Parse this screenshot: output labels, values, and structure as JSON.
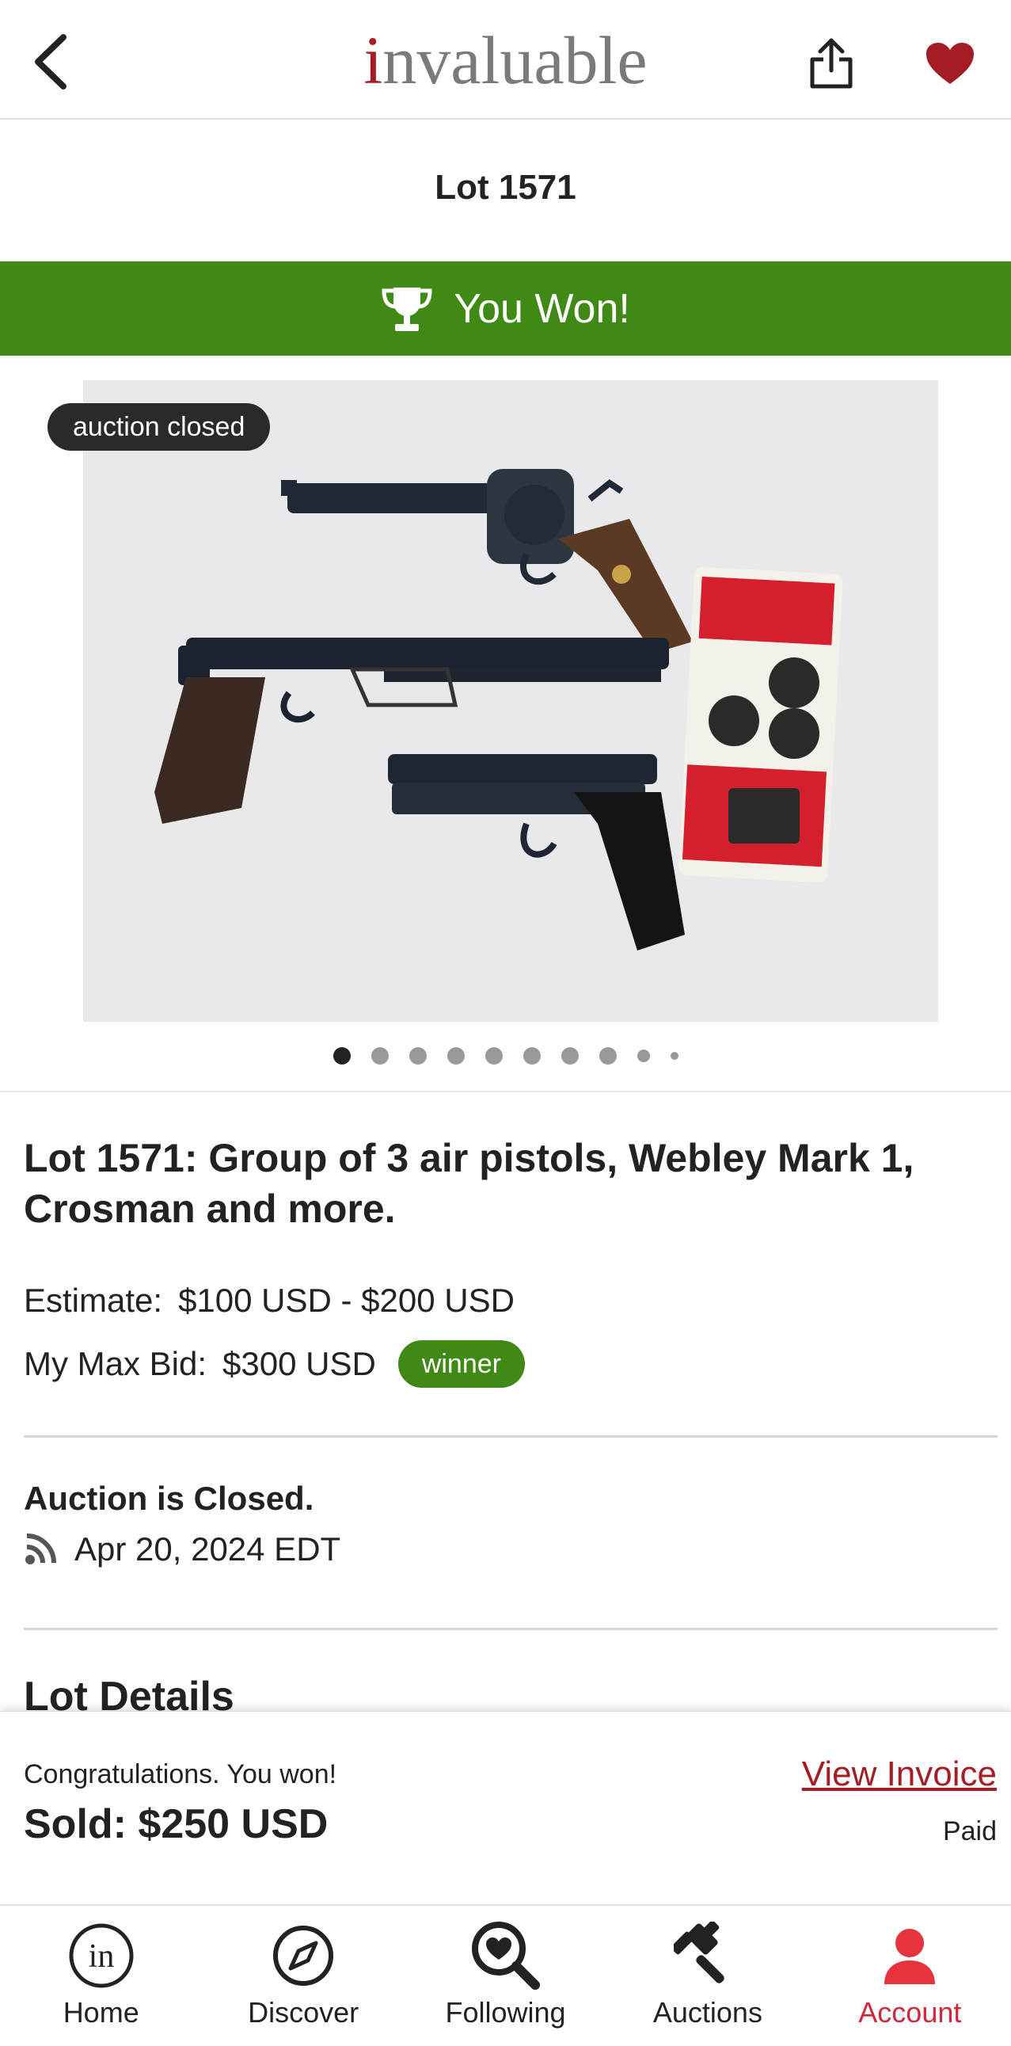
{
  "header": {
    "logo_i": "i",
    "logo_rest": "nvaluable",
    "back_icon": "chevron-left-icon",
    "share_icon": "share-icon",
    "favorite_icon": "heart-icon"
  },
  "lot_heading": "Lot 1571",
  "won_banner": {
    "text": "You Won!",
    "icon": "trophy-icon",
    "color": "#3f8a14"
  },
  "image": {
    "badge": "auction closed",
    "dot_count": 10,
    "active_dot": 0
  },
  "lot": {
    "title": "Lot 1571: Group of 3 air pistols, Webley Mark 1, Crosman and more.",
    "estimate_label": "Estimate:",
    "estimate_value": "$100 USD - $200 USD",
    "max_bid_label": "My Max Bid:",
    "max_bid_value": "$300 USD",
    "winner_badge": "winner"
  },
  "auction_status": {
    "title": "Auction is Closed.",
    "date": "Apr 20, 2024 EDT",
    "icon": "rss-icon"
  },
  "lot_details_heading": "Lot Details",
  "sold_panel": {
    "congrats": "Congratulations. You won!",
    "sold": "Sold: $250 USD",
    "view_invoice": "View Invoice",
    "paid": "Paid"
  },
  "nav": [
    {
      "label": "Home",
      "icon": "home-icon"
    },
    {
      "label": "Discover",
      "icon": "compass-icon"
    },
    {
      "label": "Following",
      "icon": "heart-search-icon"
    },
    {
      "label": "Auctions",
      "icon": "gavel-icon"
    },
    {
      "label": "Account",
      "icon": "user-icon",
      "active": true
    }
  ],
  "colors": {
    "brand": "#a51c24",
    "accent_green": "#3f8a14",
    "active_nav": "#d0283a"
  }
}
